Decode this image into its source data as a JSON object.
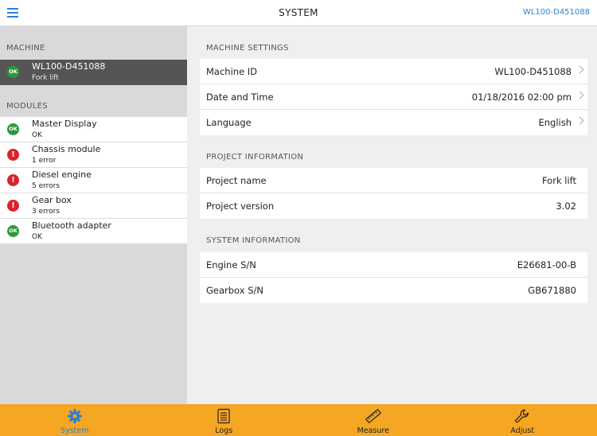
{
  "header": {
    "title": "SYSTEM",
    "machine_id": "WL100-D451088",
    "accent_color": "#2f7fd0"
  },
  "sidebar": {
    "machine_section": "MACHINE",
    "machine": {
      "name": "WL100-D451088",
      "subtitle": "Fork lift",
      "status": "OK"
    },
    "modules_section": "MODULES",
    "modules": [
      {
        "name": "Master Display",
        "status_text": "OK",
        "status": "ok",
        "badge": "OK"
      },
      {
        "name": "Chassis module",
        "status_text": "1 error",
        "status": "error",
        "badge": "!"
      },
      {
        "name": "Diesel engine",
        "status_text": "5 errors",
        "status": "error",
        "badge": "!"
      },
      {
        "name": "Gear box",
        "status_text": "3 errors",
        "status": "error",
        "badge": "!"
      },
      {
        "name": "Bluetooth adapter",
        "status_text": "OK",
        "status": "ok",
        "badge": "OK"
      }
    ]
  },
  "main": {
    "machine_settings": {
      "title": "MACHINE SETTINGS",
      "rows": [
        {
          "label": "Machine ID",
          "value": "WL100-D451088"
        },
        {
          "label": "Date and Time",
          "value": "01/18/2016 02:00 pm"
        },
        {
          "label": "Language",
          "value": "English"
        }
      ]
    },
    "project_information": {
      "title": "PROJECT INFORMATION",
      "rows": [
        {
          "label": "Project name",
          "value": "Fork lift"
        },
        {
          "label": "Project version",
          "value": "3.02"
        }
      ]
    },
    "system_information": {
      "title": "SYSTEM INFORMATION",
      "rows": [
        {
          "label": "Engine S/N",
          "value": "E26681-00-B"
        },
        {
          "label": "Gearbox S/N",
          "value": "GB671880"
        }
      ]
    }
  },
  "tabs": [
    {
      "label": "System",
      "icon": "gear-icon",
      "active": true
    },
    {
      "label": "Logs",
      "icon": "logs-icon",
      "active": false
    },
    {
      "label": "Measure",
      "icon": "ruler-icon",
      "active": false
    },
    {
      "label": "Adjust",
      "icon": "wrench-icon",
      "active": false
    }
  ],
  "colors": {
    "tabbar": "#f5a623",
    "ok": "#2e9b3a",
    "error": "#d9242b",
    "selected_row": "#555555"
  }
}
